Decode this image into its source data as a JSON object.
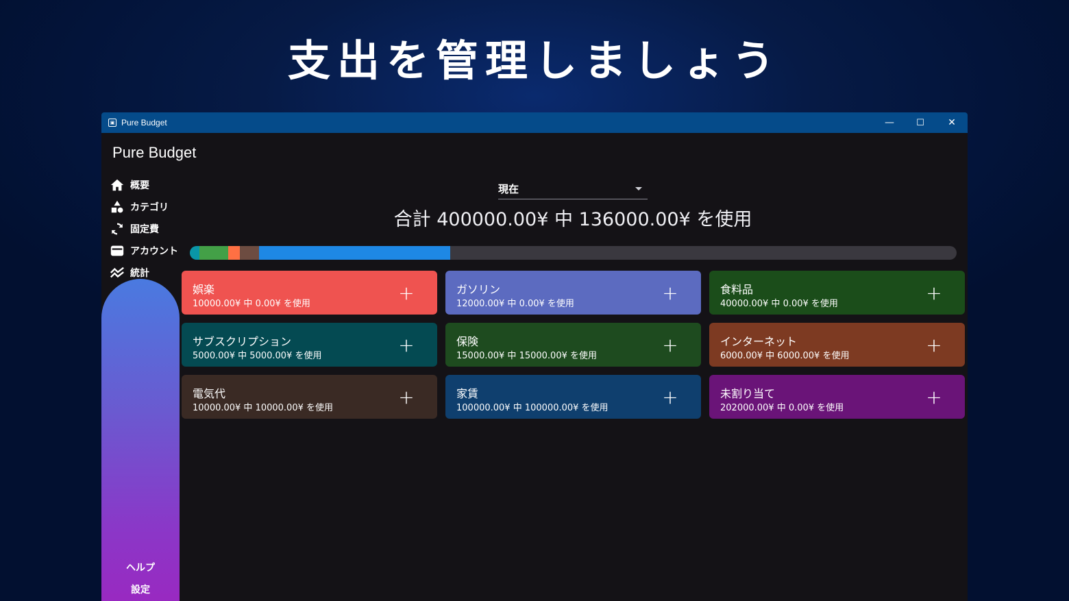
{
  "hero": {
    "title": "支出を管理しましょう"
  },
  "window": {
    "title": "Pure Budget",
    "controls": {
      "minimize": "—",
      "maximize": "☐",
      "close": "✕"
    }
  },
  "sidebar": {
    "title": "Pure Budget",
    "items": [
      {
        "label": "概要",
        "icon": "home-icon"
      },
      {
        "label": "カテゴリ",
        "icon": "shapes-icon"
      },
      {
        "label": "固定費",
        "icon": "refresh-icon"
      },
      {
        "label": "アカウント",
        "icon": "wallet-icon"
      },
      {
        "label": "統計",
        "icon": "chart-line-icon"
      }
    ],
    "footer": {
      "help": "ヘルプ",
      "settings": "設定"
    }
  },
  "main": {
    "period": {
      "selected": "現在"
    },
    "total_text": "合計 400000.00¥ 中 136000.00¥ を使用",
    "progress": {
      "total": 400000,
      "segments": [
        {
          "name": "サブスクリプション",
          "value": 5000,
          "color": "#0a96a8"
        },
        {
          "name": "保険",
          "value": 15000,
          "color": "#43a047"
        },
        {
          "name": "インターネット",
          "value": 6000,
          "color": "#ff7043"
        },
        {
          "name": "電気代",
          "value": 10000,
          "color": "#6d4c41"
        },
        {
          "name": "家賃",
          "value": 100000,
          "color": "#1e88e5"
        }
      ],
      "track_color": "#3a383f"
    },
    "categories": [
      {
        "name": "娯楽",
        "usage": "10000.00¥ 中 0.00¥ を使用",
        "color": "#ef5350"
      },
      {
        "name": "ガソリン",
        "usage": "12000.00¥ 中 0.00¥ を使用",
        "color": "#5c6bc0"
      },
      {
        "name": "食料品",
        "usage": "40000.00¥ 中 0.00¥ を使用",
        "color": "#1b4d1a"
      },
      {
        "name": "サブスクリプション",
        "usage": "5000.00¥ 中 5000.00¥ を使用",
        "color": "#044a52"
      },
      {
        "name": "保険",
        "usage": "15000.00¥ 中 15000.00¥ を使用",
        "color": "#1e4b1f"
      },
      {
        "name": "インターネット",
        "usage": "6000.00¥ 中 6000.00¥ を使用",
        "color": "#7d3a22"
      },
      {
        "name": "電気代",
        "usage": "10000.00¥ 中 10000.00¥ を使用",
        "color": "#3a2a24"
      },
      {
        "name": "家賃",
        "usage": "100000.00¥ 中 100000.00¥ を使用",
        "color": "#0f3f6e"
      },
      {
        "name": "未割り当て",
        "usage": "202000.00¥ 中 0.00¥ を使用",
        "color": "#6a1478"
      }
    ],
    "add_label": "+"
  }
}
